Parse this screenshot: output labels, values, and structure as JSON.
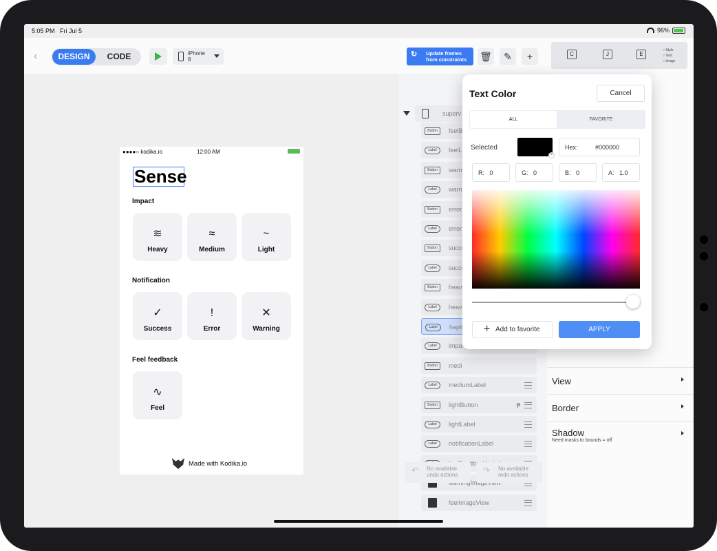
{
  "status": {
    "time": "5:05 PM",
    "date": "Fri Jul 5",
    "battery": "96%"
  },
  "toolbar": {
    "design": "DESIGN",
    "code": "CODE",
    "device_line1": "iPhone",
    "device_line2": "8"
  },
  "phone": {
    "carrier": "●●●●○ kodika.io",
    "time": "12:00 AM",
    "title": "Sense",
    "impact_header": "Impact",
    "notification_header": "Notification",
    "feedback_header": "Feel feedback",
    "tiles": [
      {
        "label": "Heavy",
        "icon": "≋"
      },
      {
        "label": "Medium",
        "icon": "≈"
      },
      {
        "label": "Light",
        "icon": "~"
      },
      {
        "label": "Success",
        "icon": "✓"
      },
      {
        "label": "Error",
        "icon": "!"
      },
      {
        "label": "Warning",
        "icon": "✕"
      },
      {
        "label": "Feel",
        "icon": "∿"
      }
    ],
    "footer": "Made with Kodika.io"
  },
  "outline": {
    "update_label_1": "Update frames",
    "update_label_2": "from constraints",
    "rows": [
      {
        "badge": "",
        "name": "superv"
      },
      {
        "badge": "Button",
        "name": "feelB"
      },
      {
        "badge": "Label",
        "name": "feelL"
      },
      {
        "badge": "Button",
        "name": "warni"
      },
      {
        "badge": "Label",
        "name": "warni"
      },
      {
        "badge": "Button",
        "name": "error"
      },
      {
        "badge": "Label",
        "name": "error"
      },
      {
        "badge": "Button",
        "name": "succe"
      },
      {
        "badge": "Label",
        "name": "succe"
      },
      {
        "badge": "Button",
        "name": "heavy"
      },
      {
        "badge": "Label",
        "name": "heavy"
      },
      {
        "badge": "Label",
        "name": "hapti"
      },
      {
        "badge": "Label",
        "name": "impa"
      },
      {
        "badge": "Button",
        "name": "medi"
      },
      {
        "badge": "Label",
        "name": "mediumLabel"
      },
      {
        "badge": "Button",
        "name": "lightButton"
      },
      {
        "badge": "Label",
        "name": "lightLabel"
      },
      {
        "badge": "Label",
        "name": "notificationLabel"
      },
      {
        "badge": "Label",
        "name": "feelFeedbackLabel"
      },
      {
        "badge": "",
        "name": "warningImageView"
      },
      {
        "badge": "",
        "name": "feelImageView"
      }
    ],
    "undo_1": "No available",
    "undo_2": "undo actions",
    "redo_1": "No available",
    "redo_2": "redo actions"
  },
  "inspector": {
    "legend": [
      "Style",
      "Text",
      "Image"
    ],
    "sections": [
      {
        "title": "View"
      },
      {
        "title": "Border"
      },
      {
        "title": "Shadow",
        "sub": "Need masks to bounds = off"
      }
    ]
  },
  "popover": {
    "title": "Text Color",
    "cancel": "Cancel",
    "tab_all": "ALL",
    "tab_favorite": "FAVORITE",
    "selected": "Selected",
    "hex_label": "Hex:",
    "hex_value": "#000000",
    "r": "R:   0",
    "g": "G:   0",
    "b": "B:   0",
    "a": "A:   1.0",
    "add_favorite": "Add to favorite",
    "apply": "APPLY",
    "selected_color": "#000000"
  }
}
